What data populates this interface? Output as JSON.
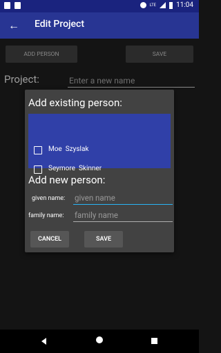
{
  "status": {
    "time": "11:04",
    "network": "LTE"
  },
  "toolbar": {
    "title": "Edit Project",
    "back_icon": "arrow-back-icon"
  },
  "actions": {
    "add_person": "ADD PERSON",
    "save": "SAVE"
  },
  "project": {
    "label": "Project:",
    "placeholder": "Enter a new name"
  },
  "dialog": {
    "existing_title": "Add existing person:",
    "people": [
      {
        "given": "Moe",
        "family": "Szyslak"
      },
      {
        "given": "Seymore",
        "family": "Skinner"
      }
    ],
    "new_title": "Add new person:",
    "given_label": "given name:",
    "given_placeholder": "given name",
    "family_label": "family name:",
    "family_placeholder": "family name",
    "cancel": "CANCEL",
    "save": "SAVE"
  },
  "colors": {
    "toolbar": "#283593",
    "statusbar": "#1a237e",
    "list": "#3040a8",
    "accent": "#29b6f6"
  }
}
